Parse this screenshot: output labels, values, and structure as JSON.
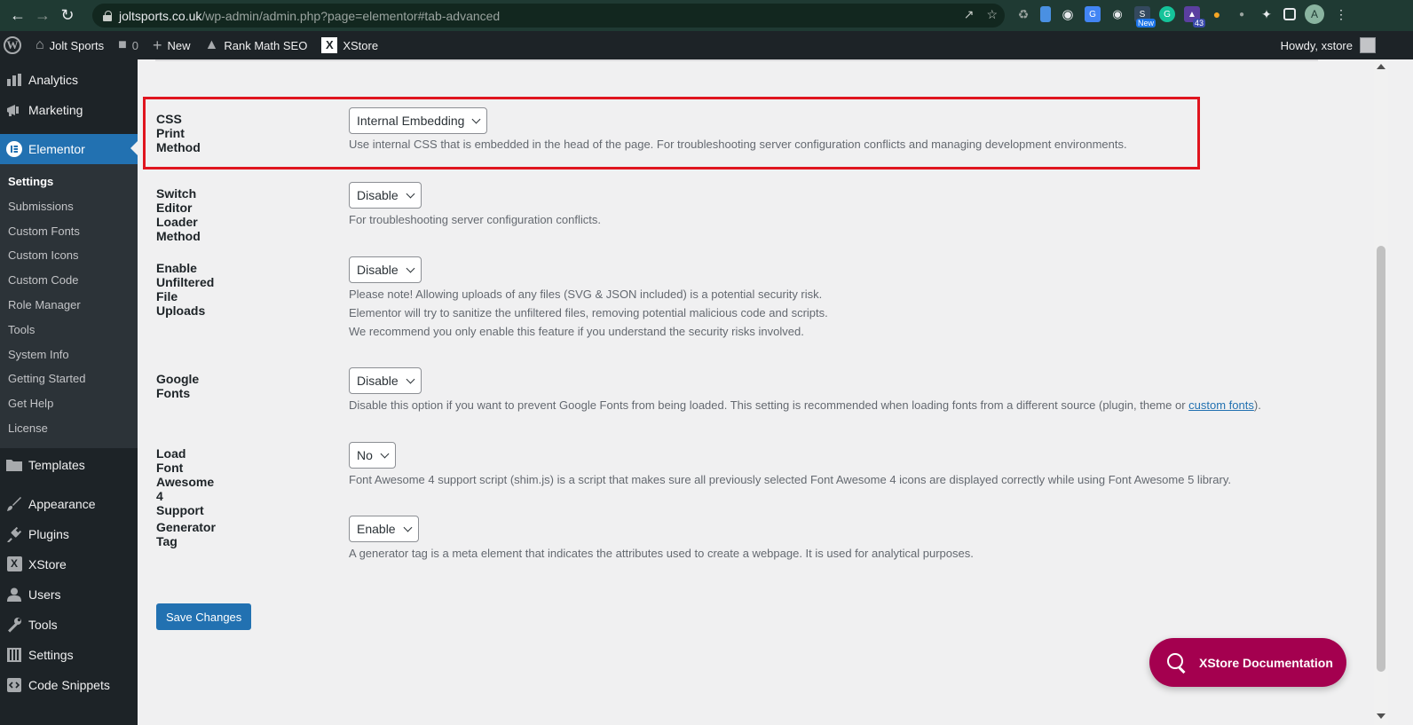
{
  "browser": {
    "url_host": "joltsports.co.uk",
    "url_path": "/wp-admin/admin.php?page=elementor#tab-advanced",
    "extension_badges": {
      "new": "New",
      "count": "43"
    },
    "profile_initial": "A"
  },
  "adminbar": {
    "site_name": "Jolt Sports",
    "comments_count": "0",
    "new_label": "New",
    "rankmath_label": "Rank Math SEO",
    "xstore_label": "XStore",
    "howdy": "Howdy, xstore"
  },
  "sidebar": {
    "top_items": [
      {
        "label": "Analytics",
        "icon": "bar-chart-icon"
      },
      {
        "label": "Marketing",
        "icon": "megaphone-icon"
      }
    ],
    "current": {
      "label": "Elementor",
      "icon": "elementor-icon"
    },
    "submenu": [
      "Settings",
      "Submissions",
      "Custom Fonts",
      "Custom Icons",
      "Custom Code",
      "Role Manager",
      "Tools",
      "System Info",
      "Getting Started",
      "Get Help",
      "License"
    ],
    "bottom_items": [
      {
        "label": "Templates",
        "icon": "folder-icon"
      },
      {
        "label": "Appearance",
        "icon": "brush-icon"
      },
      {
        "label": "Plugins",
        "icon": "plug-icon"
      },
      {
        "label": "XStore",
        "icon": "xstore-icon"
      },
      {
        "label": "Users",
        "icon": "user-icon"
      },
      {
        "label": "Tools",
        "icon": "wrench-icon"
      },
      {
        "label": "Settings",
        "icon": "sliders-icon"
      },
      {
        "label": "Code Snippets",
        "icon": "code-icon"
      }
    ]
  },
  "settings": [
    {
      "label": "CSS Print Method",
      "value": "Internal Embedding",
      "desc": [
        "Use internal CSS that is embedded in the head of the page. For troubleshooting server configuration conflicts and managing development environments."
      ]
    },
    {
      "label": "Switch Editor Loader Method",
      "value": "Disable",
      "desc": [
        "For troubleshooting server configuration conflicts."
      ]
    },
    {
      "label": "Enable Unfiltered File Uploads",
      "value": "Disable",
      "desc": [
        "Please note! Allowing uploads of any files (SVG & JSON included) is a potential security risk.",
        "Elementor will try to sanitize the unfiltered files, removing potential malicious code and scripts.",
        "We recommend you only enable this feature if you understand the security risks involved."
      ]
    },
    {
      "label": "Google Fonts",
      "value": "Disable",
      "desc_before_link": "Disable this option if you want to prevent Google Fonts from being loaded. This setting is recommended when loading fonts from a different source (plugin, theme or ",
      "desc_link": "custom fonts",
      "desc_after_link": ")."
    },
    {
      "label": "Load Font Awesome 4 Support",
      "value": "No",
      "desc": [
        "Font Awesome 4 support script (shim.js) is a script that makes sure all previously selected Font Awesome 4 icons are displayed correctly while using Font Awesome 5 library."
      ]
    },
    {
      "label": "Generator Tag",
      "value": "Enable",
      "desc": [
        "A generator tag is a meta element that indicates the attributes used to create a webpage. It is used for analytical purposes."
      ]
    }
  ],
  "save_label": "Save Changes",
  "doc_button_label": "XStore Documentation",
  "colors": {
    "admin_dark": "#1d2327",
    "accent": "#2271b1",
    "highlight_border": "#e0151f",
    "doc_button": "#a4004f"
  }
}
